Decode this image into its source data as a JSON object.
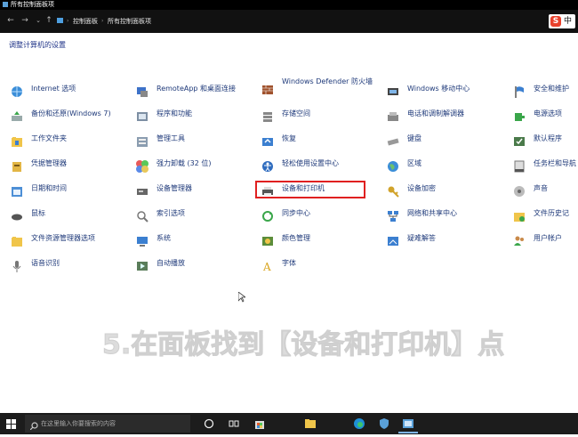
{
  "window": {
    "title": "所有控制面板项"
  },
  "address": {
    "crumb1": "控制面板",
    "crumb2": "所有控制面板项",
    "sep": "›"
  },
  "ime": {
    "logo": "S",
    "text": "中"
  },
  "header": {
    "title": "调整计算机的设置"
  },
  "items": [
    {
      "label": "Internet 选项",
      "icon": "globe-icon"
    },
    {
      "label": "RemoteApp 和桌面连接",
      "icon": "remote-desktop-icon"
    },
    {
      "label": "Windows Defender 防火墙",
      "icon": "firewall-icon"
    },
    {
      "label": "Windows 移动中心",
      "icon": "mobility-center-icon"
    },
    {
      "label": "安全和维护",
      "icon": "flag-icon"
    },
    {
      "label": "备份和还原(Windows 7)",
      "icon": "backup-icon"
    },
    {
      "label": "程序和功能",
      "icon": "programs-icon"
    },
    {
      "label": "存储空间",
      "icon": "storage-icon"
    },
    {
      "label": "电话和调制解调器",
      "icon": "phone-modem-icon"
    },
    {
      "label": "电源选项",
      "icon": "power-icon"
    },
    {
      "label": "工作文件夹",
      "icon": "work-folders-icon"
    },
    {
      "label": "管理工具",
      "icon": "admin-tools-icon"
    },
    {
      "label": "恢复",
      "icon": "recovery-icon"
    },
    {
      "label": "键盘",
      "icon": "keyboard-icon"
    },
    {
      "label": "默认程序",
      "icon": "default-programs-icon"
    },
    {
      "label": "凭据管理器",
      "icon": "credential-manager-icon"
    },
    {
      "label": "强力卸载 (32 位)",
      "icon": "uninstaller-icon"
    },
    {
      "label": "轻松使用设置中心",
      "icon": "ease-of-access-icon"
    },
    {
      "label": "区域",
      "icon": "region-icon"
    },
    {
      "label": "任务栏和导航",
      "icon": "taskbar-icon"
    },
    {
      "label": "日期和时间",
      "icon": "date-time-icon"
    },
    {
      "label": "设备管理器",
      "icon": "device-manager-icon"
    },
    {
      "label": "设备和打印机",
      "icon": "printer-icon"
    },
    {
      "label": "设备加密",
      "icon": "device-encryption-icon"
    },
    {
      "label": "声音",
      "icon": "sound-icon"
    },
    {
      "label": "鼠标",
      "icon": "mouse-icon"
    },
    {
      "label": "索引选项",
      "icon": "indexing-icon"
    },
    {
      "label": "同步中心",
      "icon": "sync-center-icon"
    },
    {
      "label": "网络和共享中心",
      "icon": "network-icon"
    },
    {
      "label": "文件历史记",
      "icon": "file-history-icon"
    },
    {
      "label": "文件资源管理器选项",
      "icon": "explorer-options-icon"
    },
    {
      "label": "系统",
      "icon": "system-icon"
    },
    {
      "label": "颜色管理",
      "icon": "color-management-icon"
    },
    {
      "label": "疑难解答",
      "icon": "troubleshooting-icon"
    },
    {
      "label": "用户帐户",
      "icon": "user-accounts-icon"
    },
    {
      "label": "语音识别",
      "icon": "speech-recognition-icon"
    },
    {
      "label": "自动播放",
      "icon": "autoplay-icon"
    },
    {
      "label": "字体",
      "icon": "fonts-icon"
    }
  ],
  "caption": {
    "text": "5.在面板找到【设备和打印机】点"
  },
  "taskbar": {
    "search_placeholder": "在这里输入你要搜索的内容",
    "apps": [
      "cortana-icon",
      "task-view-icon",
      "store-icon",
      "file-explorer-icon",
      "edge-icon",
      "security-icon",
      "control-panel-icon"
    ]
  },
  "colors": {
    "link": "#1f3a7a",
    "highlight": "#e02020",
    "taskbar": "#1c1c1c"
  }
}
